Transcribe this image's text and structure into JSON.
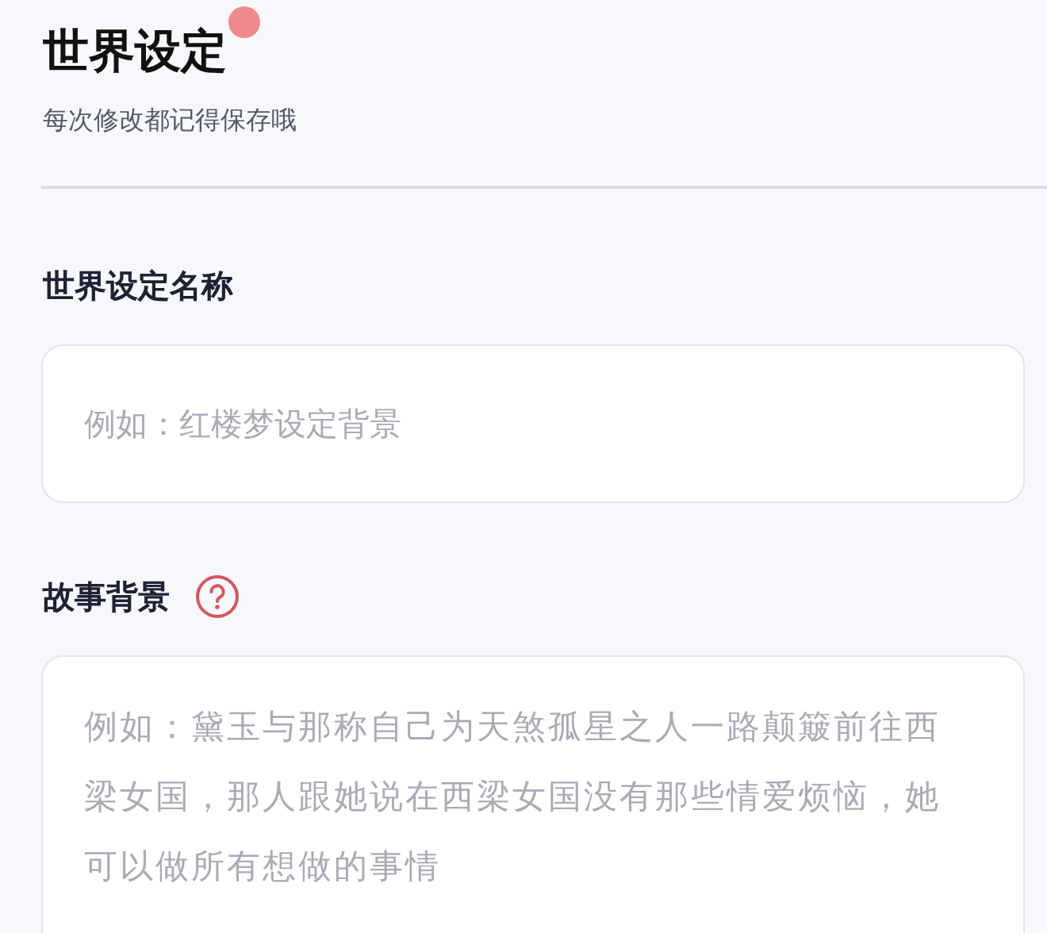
{
  "header": {
    "title": "世界设定",
    "notification_dot": true,
    "subtitle": "每次修改都记得保存哦"
  },
  "fields": [
    {
      "kind": "input",
      "label": "世界设定名称",
      "placeholder": "例如：红楼梦设定背景",
      "help": false
    },
    {
      "kind": "textarea",
      "label": "故事背景",
      "placeholder": "例如：黛玉与那称自己为天煞孤星之人一路颠簸前往西梁女国，那人跟她说在西梁女国没有那些情爱烦恼，她可以做所有想做的事情",
      "help": true
    }
  ]
}
